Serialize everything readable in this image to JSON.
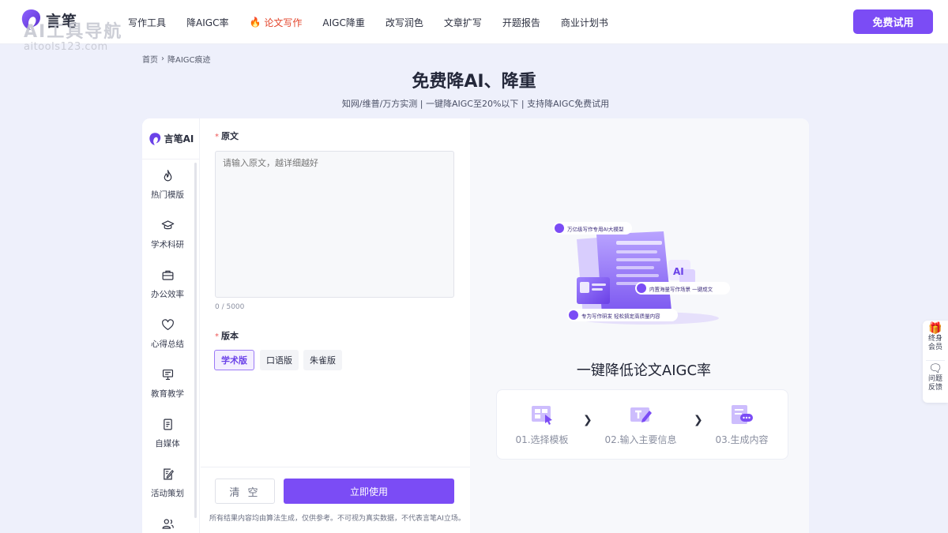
{
  "colors": {
    "accent": "#7b4cf5",
    "active_nav": "#e3452c",
    "page_bg": "#eef0fb"
  },
  "brand": {
    "name": "言笔",
    "sidebar_name": "言笔AI"
  },
  "watermark": {
    "line1": "AI工具导航",
    "line2": "aitools123.com"
  },
  "nav": {
    "items": [
      {
        "label": "写作工具",
        "active": false
      },
      {
        "label": "降AIGC率",
        "active": false
      },
      {
        "label": "论文写作",
        "active": true,
        "icon": "flame-icon"
      },
      {
        "label": "AIGC降重",
        "active": false
      },
      {
        "label": "改写润色",
        "active": false
      },
      {
        "label": "文章扩写",
        "active": false
      },
      {
        "label": "开题报告",
        "active": false
      },
      {
        "label": "商业计划书",
        "active": false
      }
    ],
    "cta": "免费试用"
  },
  "breadcrumb": {
    "home": "首页",
    "current": "降AIGC痕迹"
  },
  "hero": {
    "title": "免费降AI、降重",
    "subtitle": "知网/维普/万方实测 | 一键降AIGC至20%以下 | 支持降AIGC免费试用"
  },
  "sidebar": {
    "items": [
      {
        "label": "热门模版",
        "icon": "flame-icon"
      },
      {
        "label": "学术科研",
        "icon": "graduation-cap-icon"
      },
      {
        "label": "办公效率",
        "icon": "briefcase-icon"
      },
      {
        "label": "心得总结",
        "icon": "heart-icon"
      },
      {
        "label": "教育教学",
        "icon": "presentation-icon"
      },
      {
        "label": "自媒体",
        "icon": "document-icon"
      },
      {
        "label": "活动策划",
        "icon": "edit-note-icon"
      }
    ]
  },
  "form": {
    "source_label": "原文",
    "source_placeholder": "请输入原文，越详细越好",
    "source_value": "",
    "counter": "0 / 5000",
    "version_label": "版本",
    "versions": [
      {
        "label": "学术版",
        "selected": true
      },
      {
        "label": "口语版",
        "selected": false
      },
      {
        "label": "朱雀版",
        "selected": false
      }
    ],
    "clear_label": "清 空",
    "submit_label": "立即使用",
    "disclaimer": "所有结果内容均由算法生成，仅供参考。不可视为真实数据，不代表言笔AI立场。"
  },
  "preview": {
    "illus_tags": [
      "万亿级写作专用AI大模型",
      "内置海量写作场景 一键成文",
      "专为写作研发 轻松搞定高质量内容"
    ],
    "illus_badge": "AI",
    "title": "一键降低论文AIGC率",
    "steps": [
      "01.选择模板",
      "02.输入主要信息",
      "03.生成内容"
    ]
  },
  "floating": [
    {
      "label": "终身会员",
      "icon": "gift-icon"
    },
    {
      "label": "问题反馈",
      "icon": "feedback-icon"
    }
  ]
}
